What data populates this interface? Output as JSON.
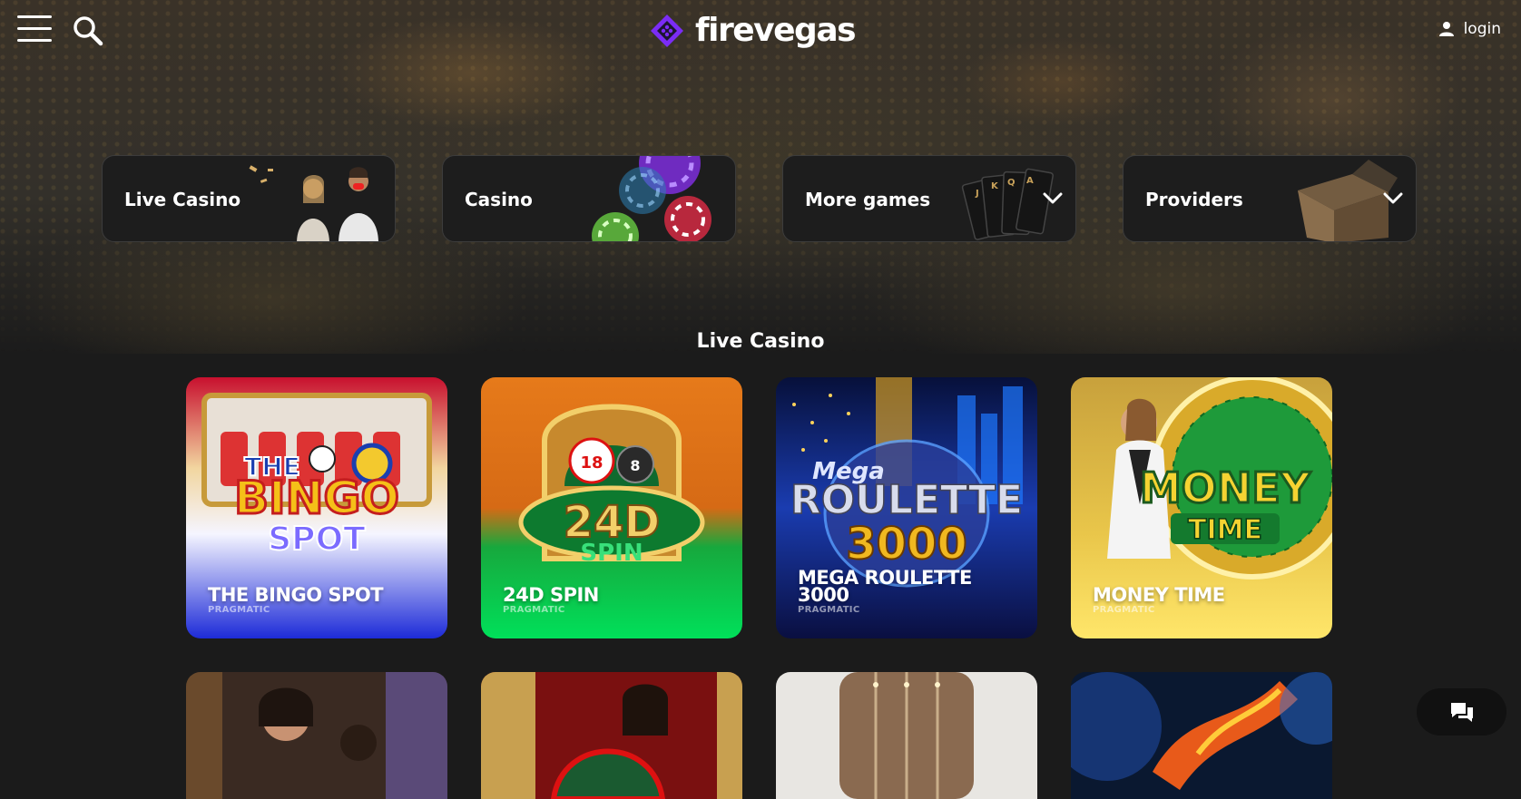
{
  "header": {
    "logo_text": "firevegas",
    "login_label": "login",
    "brand_color": "#7b2cf5"
  },
  "categories": [
    {
      "label": "Live Casino",
      "icon": "live-dealers-art",
      "has_dropdown": false
    },
    {
      "label": "Casino",
      "icon": "poker-chips-art",
      "has_dropdown": false
    },
    {
      "label": "More games",
      "icon": "playing-cards-art",
      "has_dropdown": true
    },
    {
      "label": "Providers",
      "icon": "open-box-art",
      "has_dropdown": true
    }
  ],
  "section": {
    "title": "Live Casino"
  },
  "games": [
    {
      "name": "THE BINGO SPOT",
      "provider": "PRAGMATIC"
    },
    {
      "name": "24D SPIN",
      "provider": "PRAGMATIC"
    },
    {
      "name": "MEGA ROULETTE 3000",
      "provider": "PRAGMATIC"
    },
    {
      "name": "MONEY TIME",
      "provider": "PRAGMATIC"
    }
  ],
  "art_text": {
    "bingo_logo": [
      "THE",
      "BINGO",
      "SPOT"
    ],
    "spin_logo": [
      "24D",
      "SPIN"
    ],
    "roulette_logo": [
      "Mega",
      "ROULETTE",
      "3000"
    ],
    "money_logo": [
      "MONEY",
      "TIME"
    ]
  },
  "icons": {
    "menu": "hamburger-icon",
    "search": "search-icon",
    "user": "user-icon",
    "chat": "chat-bubbles-icon",
    "chevron": "chevron-down-icon"
  }
}
